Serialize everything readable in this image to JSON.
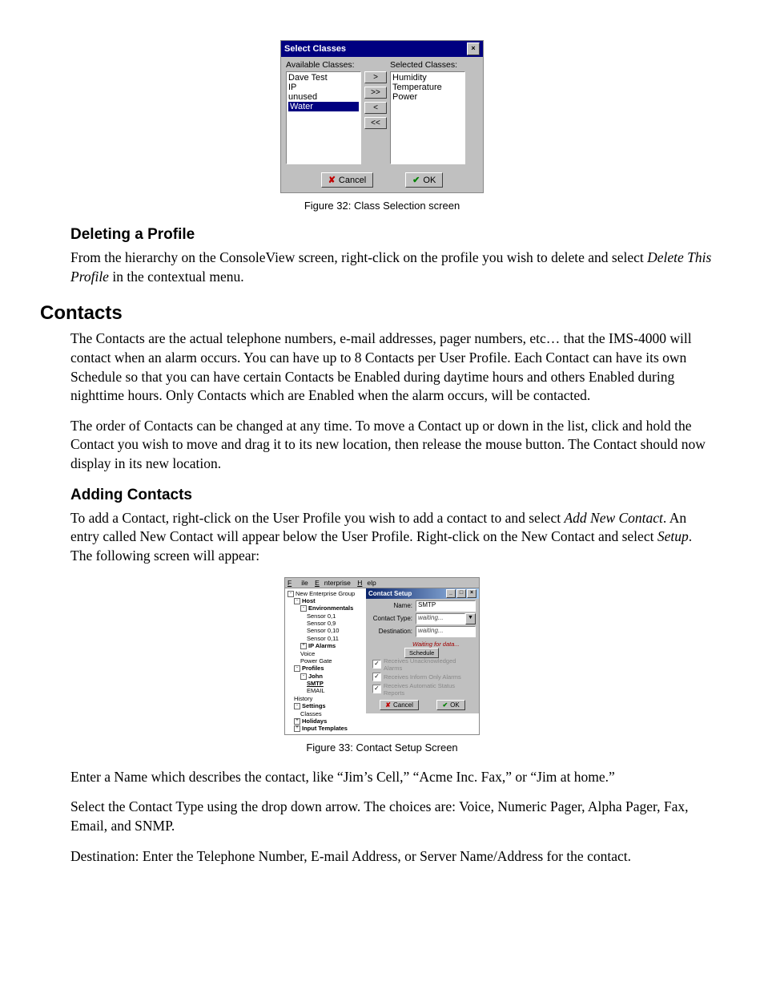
{
  "fig32": {
    "caption": "Figure 32: Class Selection screen",
    "title": "Select Classes",
    "available_label": "Available Classes:",
    "selected_label": "Selected Classes:",
    "available": [
      "Dave Test",
      "IP",
      "unused",
      "Water"
    ],
    "selected": [
      "Humidity",
      "Temperature",
      "Power"
    ],
    "btn_add": ">",
    "btn_add_all": ">>",
    "btn_remove": "<",
    "btn_remove_all": "<<",
    "cancel": "Cancel",
    "ok": "OK",
    "close_x": "×"
  },
  "sec_delete": {
    "heading": "Deleting a Profile",
    "p1a": "From the hierarchy on the ConsoleView screen, right-click on the profile you wish to delete and select ",
    "p1i": "Delete This Profile",
    "p1b": " in the contextual menu."
  },
  "sec_contacts": {
    "heading": "Contacts",
    "p1": "The Contacts are the actual telephone numbers, e-mail addresses, pager numbers, etc… that the IMS-4000 will contact when an alarm occurs. You can have up to 8 Contacts per User Profile. Each Contact can have its own Schedule so that you can have certain Contacts be Enabled during daytime hours and others Enabled during nighttime hours. Only Contacts which are Enabled when the alarm occurs, will be contacted.",
    "p2": "The order of Contacts can be changed at any time. To move a Contact up or down in the list, click and hold the Contact you wish to move and drag it to its new location, then release the mouse button. The Contact should now display in its new location."
  },
  "sec_add": {
    "heading": "Adding Contacts",
    "p1a": "To add a Contact, right-click on the User Profile you wish to add a contact to and select ",
    "p1i": "Add New Contact",
    "p1b": ". An entry called New Contact will appear below the User Profile. Right-click on the New Contact and select ",
    "p1i2": "Setup",
    "p1c": ". The following screen will appear:"
  },
  "fig33": {
    "caption": "Figure 33: Contact Setup Screen",
    "menu": {
      "file": "File",
      "enterprise": "Enterprise",
      "help": "Help"
    },
    "tree": {
      "root": "New Enterprise Group",
      "host": "Host",
      "env": "Environmentals",
      "sensors": [
        "Sensor 0,1",
        "Sensor 0,9",
        "Sensor 0,10",
        "Sensor 0,11"
      ],
      "ip": "IP Alarms",
      "voice": "Voice",
      "pg": "Power Gate",
      "profiles": "Profiles",
      "john": "John",
      "smtp": "SMTP",
      "email": "EMAIL",
      "history": "History",
      "settings": "Settings",
      "classes": "Classes",
      "holidays": "Holidays",
      "inputtpl": "Input Templates"
    },
    "panel": {
      "title": "Contact Setup",
      "name_lbl": "Name:",
      "name_val": "SMTP",
      "type_lbl": "Contact Type:",
      "type_val": "waiting...",
      "dest_lbl": "Destination:",
      "dest_val": "waiting...",
      "waiting": "Waiting for data...",
      "schedule": "Schedule",
      "chk1": "Receives Unacknowledged Alarms",
      "chk2": "Receives Inform Only Alarms",
      "chk3": "Receives Automatic Status Reports",
      "cancel": "Cancel",
      "ok": "OK"
    }
  },
  "tail": {
    "p1": "Enter a Name which describes the contact, like “Jim’s Cell,” “Acme Inc. Fax,” or “Jim at home.”",
    "p2": "Select the Contact Type using the drop down arrow. The choices are: Voice, Numeric Pager, Alpha Pager, Fax, Email, and SNMP.",
    "p3": "Destination: Enter the Telephone Number, E-mail Address, or Server Name/Address for the contact."
  }
}
